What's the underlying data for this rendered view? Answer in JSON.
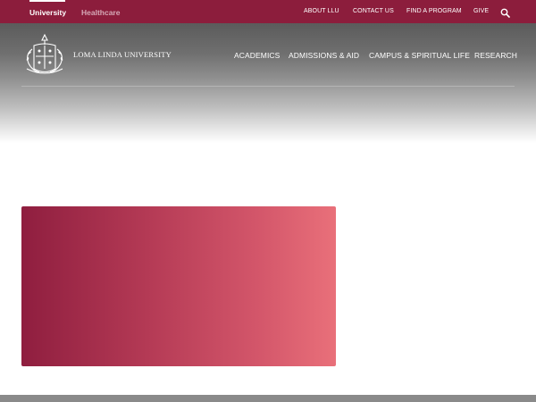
{
  "topbar": {
    "tabs": [
      {
        "label": "University",
        "active": true
      },
      {
        "label": "Healthcare",
        "active": false
      }
    ],
    "links": [
      "ABOUT LLU",
      "CONTACT US",
      "FIND A PROGRAM",
      "GIVE"
    ],
    "search_icon": "search-icon",
    "color": "#8c1d3c"
  },
  "header": {
    "brand": "LOMA LINDA UNIVERSITY",
    "logo_icon": "university-seal-icon",
    "nav": [
      "ACADEMICS",
      "ADMISSIONS & AID",
      "CAMPUS & SPIRITUAL LIFE",
      "RESEARCH"
    ]
  },
  "hero": {
    "gradient_start": "#8f1e3f",
    "gradient_end": "#e9707a"
  }
}
